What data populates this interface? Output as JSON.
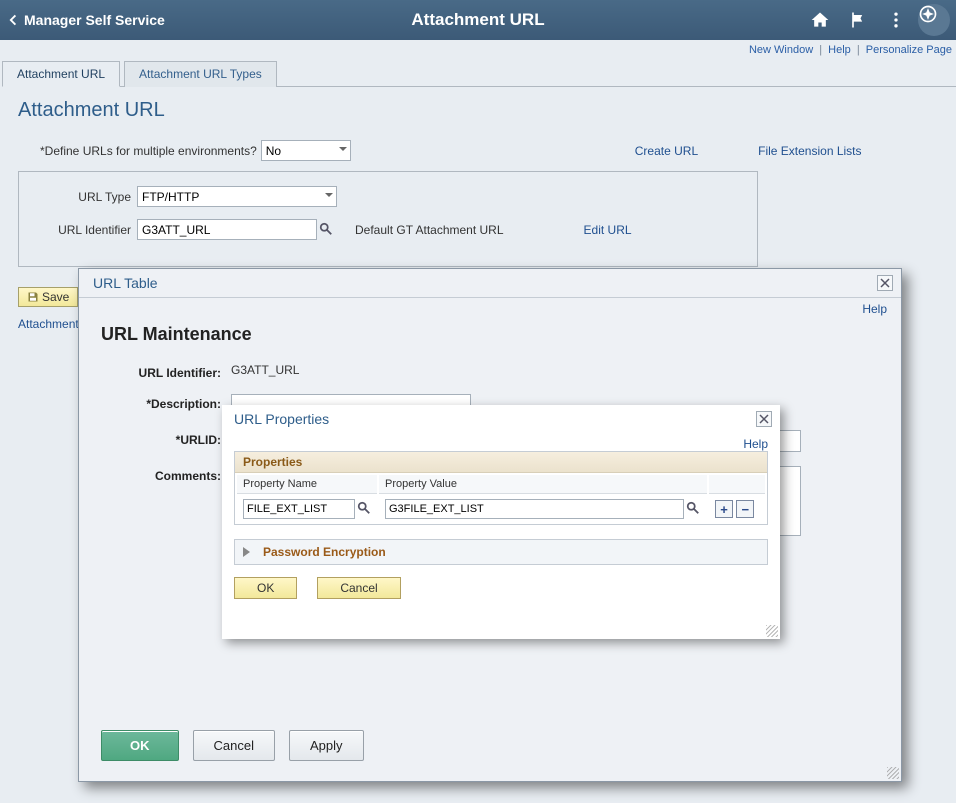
{
  "header": {
    "back_label": "Manager Self Service",
    "title": "Attachment URL"
  },
  "top_links": {
    "new_window": "New Window",
    "help": "Help",
    "personalize": "Personalize Page"
  },
  "tabs": {
    "t0": "Attachment URL",
    "t1": "Attachment URL Types"
  },
  "page": {
    "title": "Attachment URL",
    "define_label": "*Define URLs for multiple environments?",
    "define_value": "No",
    "create_url": "Create URL",
    "file_ext_lists": "File Extension Lists",
    "url_type_label": "URL Type",
    "url_type_value": "FTP/HTTP",
    "url_identifier_label": "URL Identifier",
    "url_identifier_value": "G3ATT_URL",
    "default_msg": "Default GT Attachment URL",
    "edit_url": "Edit URL",
    "save_label": "Save",
    "crumb": "Attachment U"
  },
  "url_table": {
    "modal_title": "URL Table",
    "help": "Help",
    "title": "URL Maintenance",
    "url_identifier_label": "URL Identifier:",
    "url_identifier_value": "G3ATT_URL",
    "description_label": "*Description:",
    "urlid_label": "*URLID:",
    "comments_label": "Comments:",
    "ok": "OK",
    "cancel": "Cancel",
    "apply": "Apply"
  },
  "url_props": {
    "modal_title": "URL Properties",
    "help": "Help",
    "section_title": "Properties",
    "col_name": "Property Name",
    "col_value": "Property Value",
    "name_val": "FILE_EXT_LIST",
    "value_val": "G3FILE_EXT_LIST",
    "pwd_enc": "Password Encryption",
    "ok": "OK",
    "cancel": "Cancel"
  }
}
